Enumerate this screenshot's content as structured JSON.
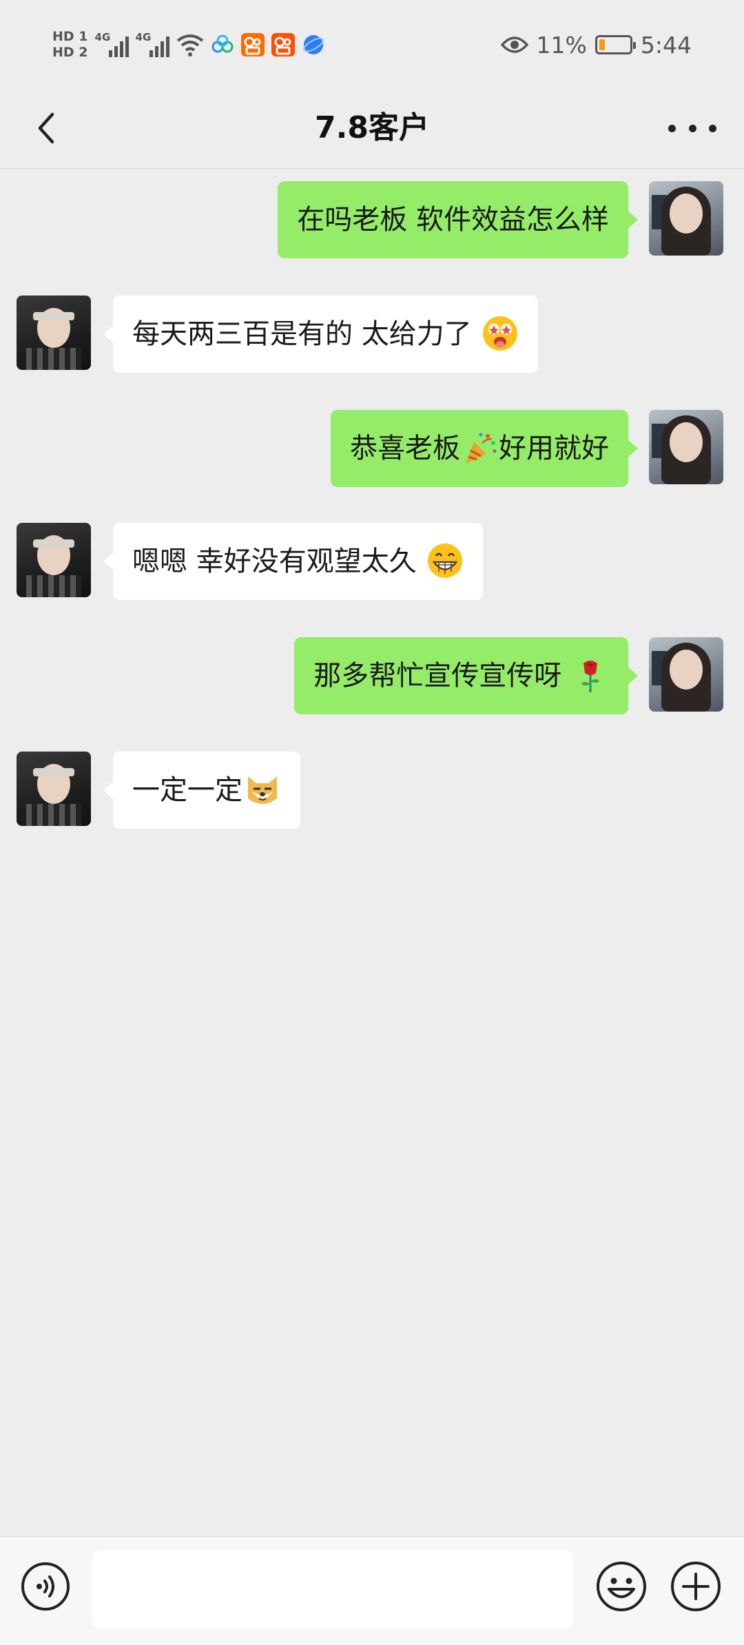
{
  "status_bar": {
    "hd1": "HD 1",
    "hd2": "HD 2",
    "net1": "4G",
    "net2": "4G",
    "battery_pct": "11%",
    "time": "5:44",
    "battery_level": 0.11
  },
  "header": {
    "title": "7.8客户"
  },
  "messages": [
    {
      "side": "out",
      "text": "在吗老板 软件效益怎么样",
      "emoji": ""
    },
    {
      "side": "in",
      "text": "每天两三百是有的 太给力了",
      "emoji": "star-eyes-tongue-emoji"
    },
    {
      "side": "out",
      "text": "恭喜老板",
      "emoji": "party-popper-emoji",
      "text_after": "好用就好"
    },
    {
      "side": "in",
      "text": "嗯嗯 幸好没有观望太久",
      "emoji": "grin-emoji"
    },
    {
      "side": "out",
      "text": "那多帮忙宣传宣传呀",
      "emoji": "rose-emoji"
    },
    {
      "side": "in",
      "text": "一定一定",
      "emoji": "doge-emoji"
    }
  ],
  "input": {
    "value": "",
    "placeholder": ""
  },
  "colors": {
    "outgoing_bubble": "#95ec69",
    "incoming_bubble": "#ffffff",
    "background": "#ededed"
  }
}
